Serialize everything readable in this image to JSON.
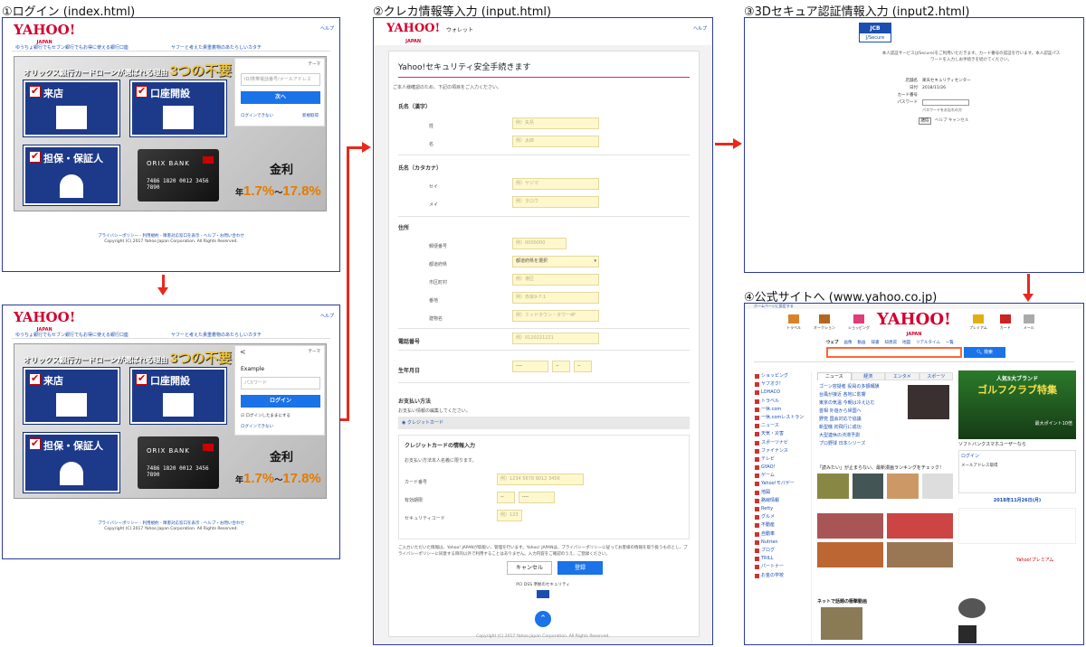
{
  "titles": {
    "step1": "①ログイン (index.html)",
    "step2": "②クレカ情報等入力 (input.html)",
    "step3": "③3Dセキュア認証情報入力 (input2.html)",
    "step4": "④公式サイトへ (www.yahoo.co.jp)"
  },
  "login": {
    "logo": "YAHOO!",
    "logo_sub": "JAPAN",
    "help": "ヘルプ",
    "top_link_left": "ゆうちょ銀行でもセブン銀行でもお得に使える銀行口座",
    "top_link_right": "ヤフーと考えた貴重着物のあたらしいカタチ",
    "banner_head_prefix": "オリックス銀行カードローンが選ばれる理由",
    "banner_head_em": "3つの不要",
    "tile1": "来店",
    "tile2": "口座開設",
    "tile3": "担保・保証人",
    "card_bank": "ORIX BANK",
    "card_num": "7486 1820 0012 3456 7890",
    "rate_label": "金利",
    "rate_text": "年1.7%～17.8%",
    "rate_prefix": "年",
    "rate_low": "1.7%",
    "rate_sep": "～",
    "rate_high": "17.8%",
    "theme": "テーマ",
    "id_placeholder": "ID/携帯電話番号/メールアドレス",
    "next_button": "次へ",
    "cant_login": "ログインできない",
    "signup": "新規取得",
    "back": "<",
    "example_user": "Example",
    "password_placeholder": "パスワード",
    "login_button": "ログイン",
    "keep_login": "ログインしたままにする",
    "footer_links": "プライバシーポリシー - 利用規約 - 障害対応窓口を表示 - ヘルプ・お問い合わせ",
    "copyright": "Copyright (C) 2017 Yahoo Japan Corporation. All Rights Reserved."
  },
  "form": {
    "logo": "YAHOO!",
    "logo_sub": "JAPAN",
    "wallet": "ウォレット",
    "help": "ヘルプ",
    "heading": "Yahoo!セキュリティ安全手続きます",
    "intro": "ご本人様確認のため、下記の項目をご入力ください。",
    "name_kanji": "氏名（漢字）",
    "sei": "姓",
    "mei": "名",
    "sei_ph": "例）矢島",
    "mei_ph": "例）太郎",
    "name_kana": "氏名（カタカナ）",
    "sei_kana": "セイ",
    "mei_kana": "メイ",
    "sei_kana_ph": "例）ヤジマ",
    "mei_kana_ph": "例）タロウ",
    "address": "住所",
    "zip": "郵便番号",
    "zip_ph": "例）0000000",
    "pref": "都道府県",
    "pref_select": "都道府県を選択",
    "city": "市区町村",
    "city_ph": "例）港区",
    "banchi": "番地",
    "banchi_ph": "例）赤坂9-7-1",
    "building": "建物名",
    "building_ph": "例）ミッドタウン・タワー4F",
    "phone": "電話番号",
    "phone_ph": "例）0120221221",
    "birth": "生年月日",
    "birth_y": "----",
    "birth_m": "--",
    "birth_d": "--",
    "payment": "お支払い方法",
    "payment_note": "お支払い情報の編集してください。",
    "credit_radio": "クレジットカード",
    "card_info": "クレジットカードの情報入力",
    "card_note": "お支払い方法本人名義に限ります。",
    "card_number": "カード番号",
    "card_number_ph": "例）1234 5678 9012 3456",
    "expiry": "有効期限",
    "expiry_m": "--",
    "expiry_y": "----",
    "security_code": "セキュリティコード",
    "security_code_ph": "例）123",
    "privacy_note": "ご入力いただいた情報は、Yahoo! JAPANが取扱い、管理を行います。Yahoo! JAPANは、プライバシーポリシーに従ってお客様の情報を取り扱うものとし、プライバシーポリシーに同意する目的以外で利用することはありません。入力内容をご確認のうえ、ご登録ください。",
    "cancel": "キャンセル",
    "register": "登録",
    "pci": "PCI DSS 準拠のセキュリティ",
    "copyright": "Copyright (C) 2017 Yahoo Japan Corporation. All Rights Reserved."
  },
  "secure3d": {
    "jcb": "JCB",
    "jsecure": "J/Secure",
    "intro": "本人認証サービス(J/Secure)をご利用いただきます。カード番号の認証を行います。本人認証パスワードを入力しお手続きを続けてください。",
    "store_label": "店舗名",
    "store": "楽天セキュリティセンター",
    "date_label": "日付",
    "date": "2018/11/26",
    "card_label": "カード番号",
    "pw_label": "パスワード",
    "forgot": "パスワードをお忘れの方",
    "submit": "送信",
    "help_cancel": "ヘルプ キャンセル"
  },
  "yahoo": {
    "top_note": "ホームページに設定する",
    "logo": "YAHOO!",
    "logo_sub": "JAPAN",
    "tabs": [
      "ウェブ",
      "画像",
      "動画",
      "辞書",
      "知恵袋",
      "地図",
      "リアルタイム",
      "一覧"
    ],
    "search_button": "検索",
    "icons": [
      "トラベル",
      "オークション",
      "ショッピング",
      "プレミアム",
      "カード",
      "メール"
    ],
    "sidebar": [
      "ショッピング",
      "ヤフオク!",
      "LOHACO",
      "トラベル",
      "一休.com",
      "一休.comレストラン",
      "ニュース",
      "天気・災害",
      "スポーツナビ",
      "ファイナンス",
      "テレビ",
      "GYAO!",
      "ゲーム",
      "Yahoo!モバゲー",
      "地図",
      "路線情報",
      "Retty",
      "グルメ",
      "不動産",
      "自動車",
      "Nutrien",
      "ブログ",
      "TRILL",
      "パートナー",
      "お金の学校"
    ],
    "news_tabs": [
      "ニュース",
      "経済",
      "エンタメ",
      "スポーツ"
    ],
    "news": [
      "ゴーン容疑者 役員の多額報酬",
      "台風が接近 各地に影響",
      "東京の気温 今朝は冷え込む",
      "首相 外遊から帰国へ",
      "野党 国会対応で協議",
      "新型機 初飛行に成功",
      "大型連休の渋滞予測",
      "プロ野球 日本シリーズ"
    ],
    "ad_head": "人気5大ブランド",
    "ad_title": "ゴルフクラブ特集",
    "ad_sub": "最大ポイント10倍",
    "softbank": "ソフトバンクスマホユーザーなら",
    "ranking": "「読みたい」が止まらない、最新漫画ランキングをチェック！",
    "login_box": "ログイン",
    "mail_label": "メールアドレス取得",
    "premium": "Yahoo!プレミアム",
    "date_box": "2018年11月26日(月)",
    "footer_headline": "ネットで話題の衝撃動画"
  }
}
